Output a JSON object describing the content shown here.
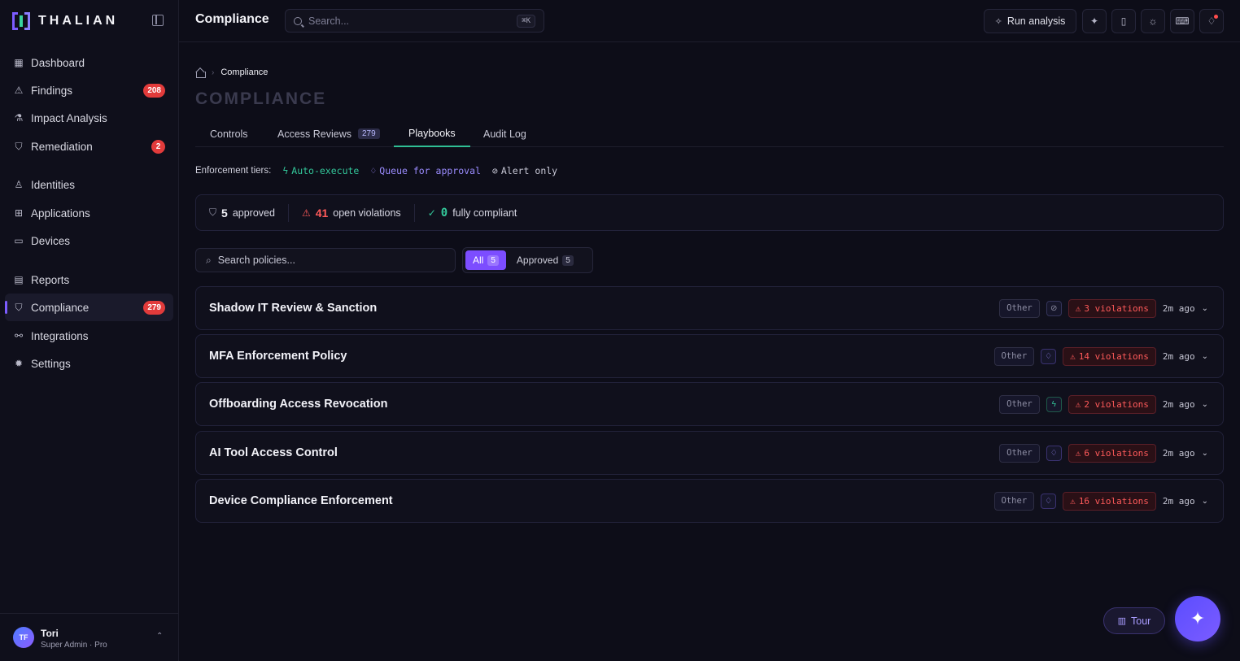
{
  "brand": {
    "name": "THALIAN"
  },
  "sidebar": {
    "items": [
      {
        "label": "Dashboard",
        "icon": "grid-icon"
      },
      {
        "label": "Findings",
        "icon": "warning-icon",
        "count": "208"
      },
      {
        "label": "Impact Analysis",
        "icon": "flask-icon"
      },
      {
        "label": "Remediation",
        "icon": "shield-check-icon",
        "count": "2"
      },
      {
        "label": "Identities",
        "icon": "user-icon"
      },
      {
        "label": "Applications",
        "icon": "app-plus-icon"
      },
      {
        "label": "Devices",
        "icon": "monitor-icon"
      },
      {
        "label": "Reports",
        "icon": "document-icon"
      },
      {
        "label": "Compliance",
        "icon": "shield-icon",
        "count": "279"
      },
      {
        "label": "Integrations",
        "icon": "nodes-icon"
      },
      {
        "label": "Settings",
        "icon": "gear-icon"
      }
    ],
    "user": {
      "initials": "TF",
      "name": "Tori",
      "role": "Super Admin · Pro"
    }
  },
  "header": {
    "title": "Compliance",
    "search_placeholder": "Search...",
    "search_shortcut": "⌘K",
    "run_label": "Run analysis"
  },
  "main": {
    "breadcrumb": "Compliance",
    "page_title": "COMPLIANCE",
    "tabs": [
      {
        "label": "Controls"
      },
      {
        "label": "Access Reviews",
        "count": "279"
      },
      {
        "label": "Playbooks"
      },
      {
        "label": "Audit Log"
      }
    ],
    "tiers": {
      "label": "Enforcement tiers:",
      "auto": "Auto-execute",
      "queue": "Queue for approval",
      "alert": "Alert only"
    },
    "stats": {
      "approved_num": "5",
      "approved_label": "approved",
      "violations_num": "41",
      "violations_label": "open violations",
      "compliant_num": "0",
      "compliant_label": "fully compliant"
    },
    "policy_search_placeholder": "Search policies...",
    "filters": [
      {
        "label": "All",
        "count": "5"
      },
      {
        "label": "Approved",
        "count": "5"
      }
    ],
    "policies": [
      {
        "title": "Shadow IT Review & Sanction",
        "category": "Other",
        "tier": "alert",
        "violations": "3 violations",
        "ago": "2m ago"
      },
      {
        "title": "MFA Enforcement Policy",
        "category": "Other",
        "tier": "queue",
        "violations": "14 violations",
        "ago": "2m ago"
      },
      {
        "title": "Offboarding Access Revocation",
        "category": "Other",
        "tier": "auto",
        "violations": "2 violations",
        "ago": "2m ago"
      },
      {
        "title": "AI Tool Access Control",
        "category": "Other",
        "tier": "queue",
        "violations": "6 violations",
        "ago": "2m ago"
      },
      {
        "title": "Device Compliance Enforcement",
        "category": "Other",
        "tier": "queue",
        "violations": "16 violations",
        "ago": "2m ago"
      }
    ],
    "tour_label": "Tour"
  }
}
